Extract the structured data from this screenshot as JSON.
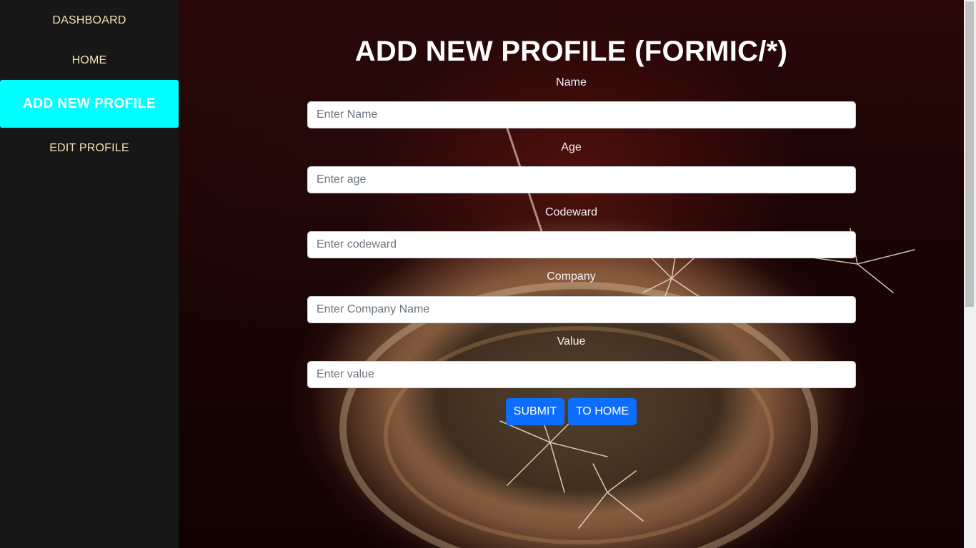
{
  "sidebar": {
    "items": [
      {
        "label": "DASHBOARD"
      },
      {
        "label": "HOME"
      },
      {
        "label": "ADD NEW PROFILE"
      },
      {
        "label": "EDIT PROFILE"
      }
    ],
    "active_color": "#00ffff"
  },
  "main": {
    "title": "ADD NEW PROFILE (FORMIC/*)",
    "fields": [
      {
        "label": "Name",
        "placeholder": "Enter Name"
      },
      {
        "label": "Age",
        "placeholder": "Enter age"
      },
      {
        "label": "Codeward",
        "placeholder": "Enter codeward"
      },
      {
        "label": "Company",
        "placeholder": "Enter Company Name"
      },
      {
        "label": "Value",
        "placeholder": "Enter value"
      }
    ],
    "buttons": {
      "submit": "SUBMIT",
      "to_home": "TO HOME"
    },
    "button_color": "#0d6efd"
  }
}
